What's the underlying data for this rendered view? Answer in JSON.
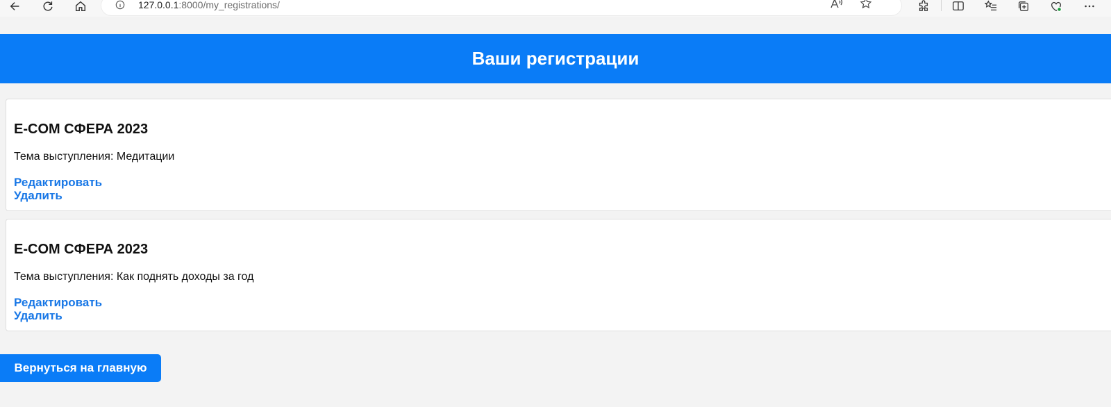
{
  "browser": {
    "url_host": "127.0.0.1",
    "url_port": ":8000",
    "url_path": "/my_registrations/",
    "icons": {
      "back": "arrow-left-icon",
      "refresh": "refresh-icon",
      "home": "home-icon",
      "info": "info-icon",
      "read_aloud": "read-aloud-icon",
      "favorite": "star-icon",
      "extensions": "puzzle-icon",
      "split_screen": "split-screen-icon",
      "favorites": "favorites-list-icon",
      "collections": "collections-icon",
      "health": "browser-essentials-icon",
      "more": "more-icon"
    }
  },
  "header": {
    "title": "Ваши регистрации",
    "background": "#0a7cf7"
  },
  "registrations": [
    {
      "event": "E-COM СФЕРА 2023",
      "topic": "Тема выступления: Медитации",
      "edit_label": "Редактировать",
      "delete_label": "Удалить"
    },
    {
      "event": "E-COM СФЕРА 2023",
      "topic": "Тема выступления: Как поднять доходы за год",
      "edit_label": "Редактировать",
      "delete_label": "Удалить"
    }
  ],
  "back_button": {
    "label": "Вернуться на главную"
  },
  "colors": {
    "accent": "#0a7cf7",
    "link": "#1877e6",
    "page_background": "#f3f3f3"
  }
}
